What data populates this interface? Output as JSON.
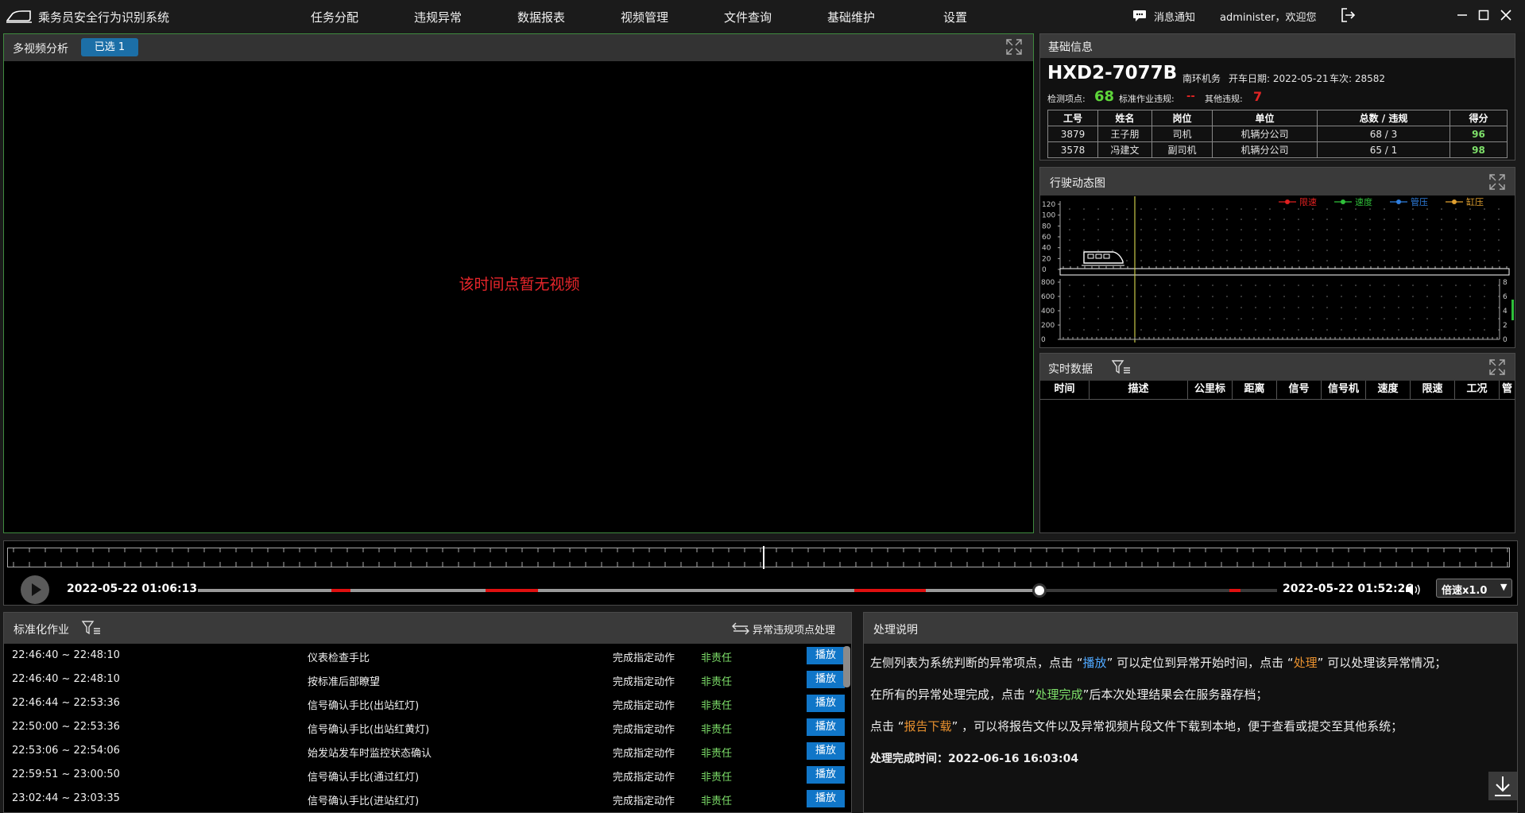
{
  "app": {
    "title": "乘务员安全行为识别系统"
  },
  "nav": [
    {
      "label": "任务分配"
    },
    {
      "label": "违规异常"
    },
    {
      "label": "数据报表"
    },
    {
      "label": "视频管理"
    },
    {
      "label": "文件查询"
    },
    {
      "label": "基础维护"
    },
    {
      "label": "设置"
    }
  ],
  "header": {
    "notify_label": "消息通知",
    "user_label": "administer，欢迎您"
  },
  "video": {
    "title": "多视频分析",
    "selected_badge": "已选 1",
    "no_video_msg": "该时间点暂无视频",
    "msg_color": "#e8262b"
  },
  "basic_info": {
    "title": "基础信息",
    "train_id": "HXD2-7077B",
    "depot": "南环机务",
    "date_label": "开车日期: 2022-05-21",
    "trip_label": "车次: 28582",
    "check_points_label": "检测项点:",
    "check_points_value": "68",
    "std_violation_label": "标准作业违规:",
    "std_violation_value": "--",
    "other_violation_label": "其他违规:",
    "other_violation_value": "7",
    "table_headers": [
      "工号",
      "姓名",
      "岗位",
      "单位",
      "总数 / 违规",
      "得分"
    ],
    "rows": [
      [
        "3879",
        "王子朋",
        "司机",
        "机辆分公司",
        "68 / 3",
        "96"
      ],
      [
        "3578",
        "冯建文",
        "副司机",
        "机辆分公司",
        "65 / 1",
        "98"
      ]
    ]
  },
  "dynamic_chart": {
    "title": "行驶动态图",
    "legend": [
      {
        "name": "限速",
        "color": "#e02020"
      },
      {
        "name": "速度",
        "color": "#2fbf3a"
      },
      {
        "name": "管压",
        "color": "#2f7fe0"
      },
      {
        "name": "缸压",
        "color": "#e0a030"
      }
    ],
    "speed_ticks": [
      "120",
      "100",
      "80",
      "60",
      "40",
      "20",
      "0"
    ],
    "pressure_ticks": [
      "800",
      "600",
      "400",
      "200",
      "0"
    ],
    "right_ticks": [
      "8",
      "6",
      "4",
      "2",
      "0"
    ]
  },
  "realtime": {
    "title": "实时数据",
    "columns": [
      "时间",
      "描述",
      "公里标",
      "距离",
      "信号",
      "信号机",
      "速度",
      "限速",
      "工况",
      "管"
    ]
  },
  "timeline": {
    "start_time": "2022-05-22 01:06:13",
    "end_time": "2022-05-22 01:52:26",
    "speed_label": "倍速x1.0",
    "progress": 0.78
  },
  "tasks": {
    "title": "标准化作业",
    "handle_label": "异常违规项点处理",
    "play_label": "播放",
    "rows": [
      {
        "time": "22:46:40 ~ 22:48:10",
        "name": "仪表检查手比",
        "action": "完成指定动作",
        "duty": "非责任"
      },
      {
        "time": "22:46:40 ~ 22:48:10",
        "name": "按标准后部瞭望",
        "action": "完成指定动作",
        "duty": "非责任"
      },
      {
        "time": "22:46:44 ~ 22:53:36",
        "name": "信号确认手比(出站红灯)",
        "action": "完成指定动作",
        "duty": "非责任"
      },
      {
        "time": "22:50:00 ~ 22:53:36",
        "name": "信号确认手比(出站红黄灯)",
        "action": "完成指定动作",
        "duty": "非责任"
      },
      {
        "time": "22:53:06 ~ 22:54:06",
        "name": "始发站发车时监控状态确认",
        "action": "完成指定动作",
        "duty": "非责任"
      },
      {
        "time": "22:59:51 ~ 23:00:50",
        "name": "信号确认手比(通过红灯)",
        "action": "完成指定动作",
        "duty": "非责任"
      },
      {
        "time": "23:02:44 ~ 23:03:35",
        "name": "信号确认手比(进站红灯)",
        "action": "完成指定动作",
        "duty": "非责任"
      }
    ]
  },
  "process": {
    "title": "处理说明",
    "line1_a": "左侧列表为系统判断的异常项点，点击 “",
    "line1_play": "播放",
    "line1_b": "” 可以定位到异常开始时间，点击 “",
    "line1_handle": "处理",
    "line1_c": "” 可以处理该异常情况；",
    "line2_a": "在所有的异常处理完成，点击 “",
    "line2_done": "处理完成",
    "line2_b": "”后本次处理结果会在服务器存档；",
    "line3_a": "点击 “",
    "line3_report": "报告下载",
    "line3_b": "” ，可以将报告文件以及异常视频片段文件下载到本地，便于查看或提交至其他系统；",
    "finish_label": "处理完成时间：2022-06-16 16:03:04"
  }
}
